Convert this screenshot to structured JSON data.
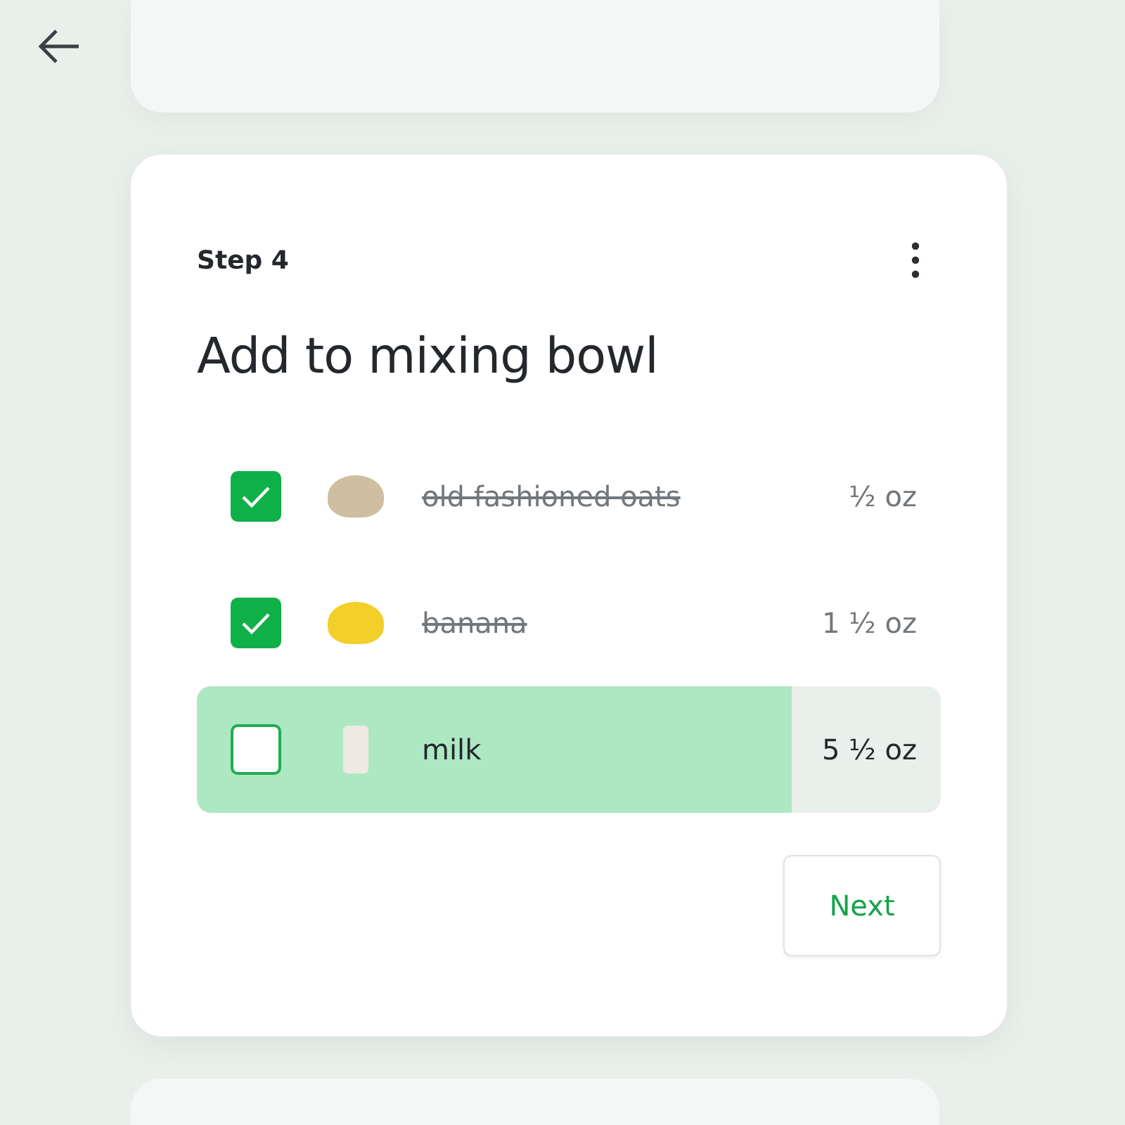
{
  "step": {
    "label": "Step 4",
    "title": "Add to mixing bowl"
  },
  "ingredients": [
    {
      "name": "old fashioned oats",
      "amount": "½ oz",
      "checked": true,
      "active": false,
      "kind": "oats"
    },
    {
      "name": "banana",
      "amount": "1 ½ oz",
      "checked": true,
      "active": false,
      "kind": "banana"
    },
    {
      "name": "milk",
      "amount": "5 ½ oz",
      "checked": false,
      "active": true,
      "level": 0.8,
      "kind": "milk"
    }
  ],
  "next_button": "Next"
}
